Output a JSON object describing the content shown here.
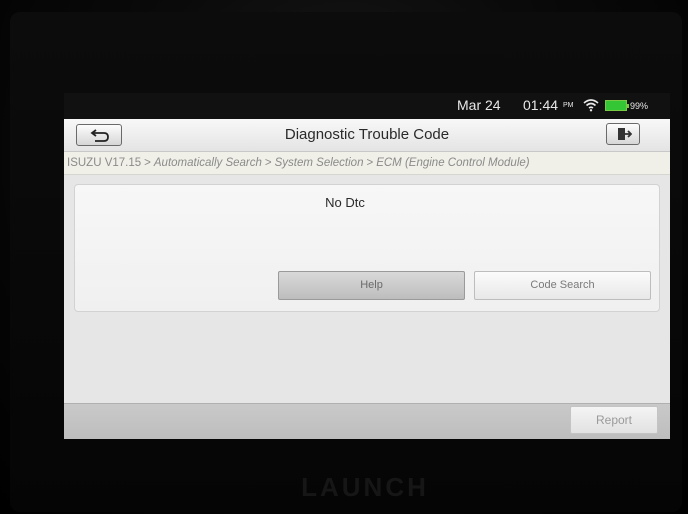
{
  "status_bar": {
    "date": "Mar 24",
    "time": "01:44",
    "ampm": "PM",
    "battery_percent": "99%",
    "wifi_icon": "wifi-icon",
    "battery_icon": "battery-icon",
    "battery_level": 0.99,
    "battery_color": "#34c634"
  },
  "header": {
    "title": "Diagnostic Trouble Code",
    "back_icon": "back-arrow-icon",
    "exit_icon": "exit-door-icon"
  },
  "breadcrumb": {
    "items": [
      "ISUZU V17.15",
      "Automatically Search",
      "System Selection",
      "ECM (Engine Control Module)"
    ],
    "separator": ">"
  },
  "dtc_panel": {
    "message": "No Dtc",
    "help_label": "Help",
    "code_search_label": "Code Search"
  },
  "toolbar": {
    "report_label": "Report"
  },
  "device": {
    "brand": "LAUNCH"
  }
}
